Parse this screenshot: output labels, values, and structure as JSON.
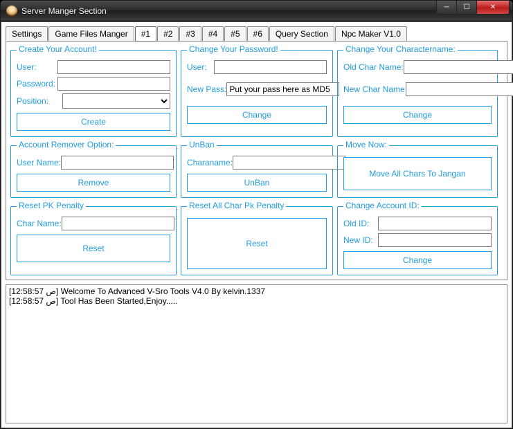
{
  "window": {
    "title": "Server Manger Section"
  },
  "tabs": [
    {
      "label": "Settings"
    },
    {
      "label": "Game Files Manger"
    },
    {
      "label": "#1"
    },
    {
      "label": "#2"
    },
    {
      "label": "#3"
    },
    {
      "label": "#4"
    },
    {
      "label": "#5"
    },
    {
      "label": "#6"
    },
    {
      "label": "Query Section"
    },
    {
      "label": "Npc Maker V1.0"
    }
  ],
  "active_tab": 2,
  "groups": {
    "create_account": {
      "title": "Create Your Account!",
      "user_label": "User:",
      "password_label": "Password:",
      "position_label": "Position:",
      "user_value": "",
      "password_value": "",
      "position_value": "",
      "create_button": "Create"
    },
    "change_password": {
      "title": "Change Your Password!",
      "user_label": "User:",
      "newpass_label": "New Pass:",
      "user_value": "",
      "newpass_value": "Put your pass here as MD5",
      "change_button": "Change"
    },
    "change_charname": {
      "title": "Change Your Charactername:",
      "old_label": "Old Char Name:",
      "new_label": "New Char Name:",
      "old_value": "",
      "new_value": "",
      "change_button": "Change"
    },
    "remover": {
      "title": "Account Remover Option:",
      "username_label": "User Name:",
      "username_value": "",
      "remove_button": "Remove"
    },
    "unban": {
      "title": "UnBan",
      "charaname_label": "Charaname:",
      "charaname_value": "",
      "unban_button": "UnBan"
    },
    "move_now": {
      "title": "Move Now:",
      "move_button": "Move All Chars To Jangan"
    },
    "reset_pk": {
      "title": "Reset PK Penalty",
      "charname_label": "Char Name:",
      "charname_value": "",
      "reset_button": "Reset"
    },
    "reset_all_pk": {
      "title": "Reset All Char Pk Penalty",
      "reset_button": "Reset"
    },
    "change_account_id": {
      "title": "Change Account ID:",
      "old_label": "Old ID:",
      "new_label": "New ID:",
      "old_value": "",
      "new_value": "",
      "change_button": "Change"
    }
  },
  "log_lines": [
    "[12:58:57 ص] Welcome To Advanced V-Sro Tools V4.0 By kelvin.1337",
    "[12:58:57 ص] Tool Has Been Started,Enjoy....."
  ]
}
